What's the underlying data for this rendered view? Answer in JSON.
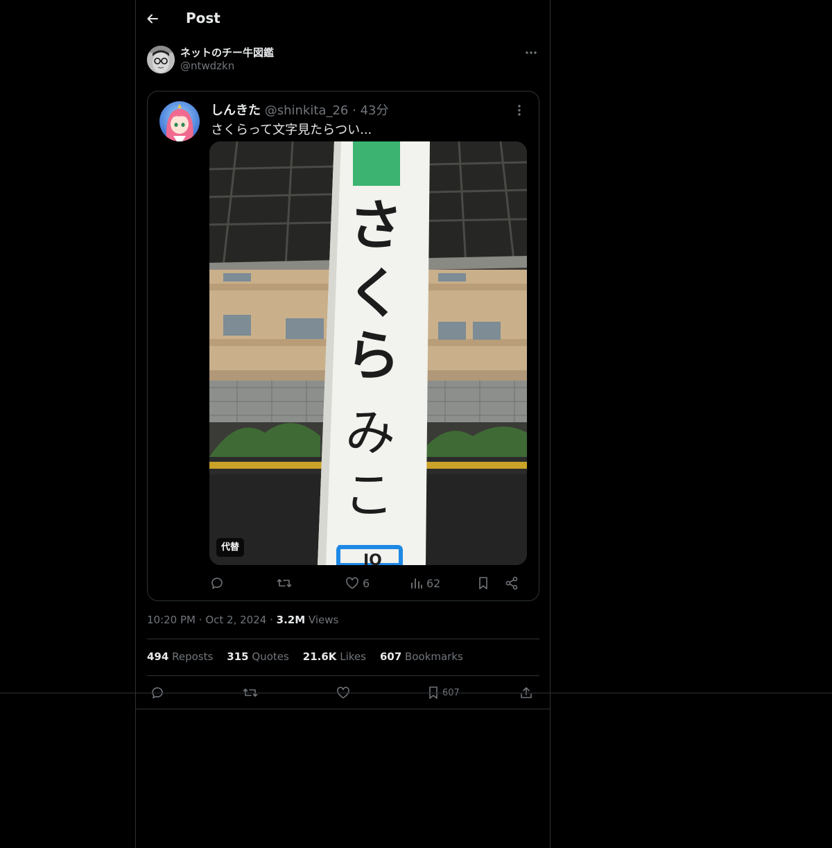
{
  "header": {
    "title": "Post"
  },
  "author": {
    "name": "ネットのチー牛図鑑",
    "handle": "@ntwdzkn"
  },
  "quoted": {
    "name": "しんきた",
    "handle": "@shinkita_26",
    "time_sep": "·",
    "time": "43分",
    "text": "さくらって文字見たらつい...",
    "sign_text": [
      "さ",
      "く",
      "ら",
      "み",
      "こ"
    ],
    "alt_badge": "代替",
    "actions": {
      "likes": "6",
      "views": "62"
    }
  },
  "timestamp": {
    "time": "10:20 PM",
    "sep1": "·",
    "date": "Oct 2, 2024",
    "sep2": "·",
    "views_value": "3.2M",
    "views_label": "Views"
  },
  "stats": [
    {
      "value": "494",
      "label": "Reposts"
    },
    {
      "value": "315",
      "label": "Quotes"
    },
    {
      "value": "21.6K",
      "label": "Likes"
    },
    {
      "value": "607",
      "label": "Bookmarks"
    }
  ],
  "actions": {
    "bookmark_count": "607"
  },
  "colors": {
    "background": "#000000",
    "text": "#e7e9ea",
    "muted": "#71767b",
    "border": "#2f3336",
    "sign_green": "#3cb371",
    "sign_blue": "#1e88e5"
  },
  "icons": [
    "back-arrow-icon",
    "more-horizontal-icon",
    "more-vertical-icon",
    "reply-icon",
    "retweet-icon",
    "heart-icon",
    "views-icon",
    "bookmark-icon",
    "share-icon",
    "upload-icon"
  ]
}
